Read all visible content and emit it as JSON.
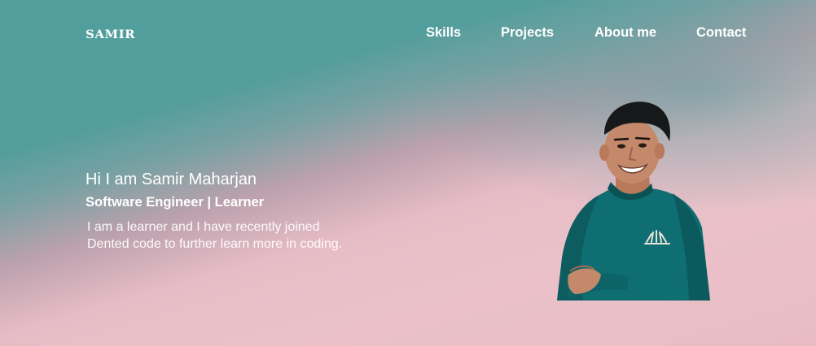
{
  "header": {
    "logo": "SAMIR",
    "nav": {
      "skills": "Skills",
      "projects": "Projects",
      "about": "About me",
      "contact": "Contact"
    }
  },
  "hero": {
    "greeting": "Hi I am Samir Maharjan",
    "role": "Software Engineer | Learner",
    "description": "I am a learner and I have recently joined Dented code  to further learn more in coding."
  },
  "colors": {
    "teal": "#519e9c",
    "pink": "#ebc1c9",
    "sweater": "#0f6e72",
    "text": "#ffffff"
  }
}
